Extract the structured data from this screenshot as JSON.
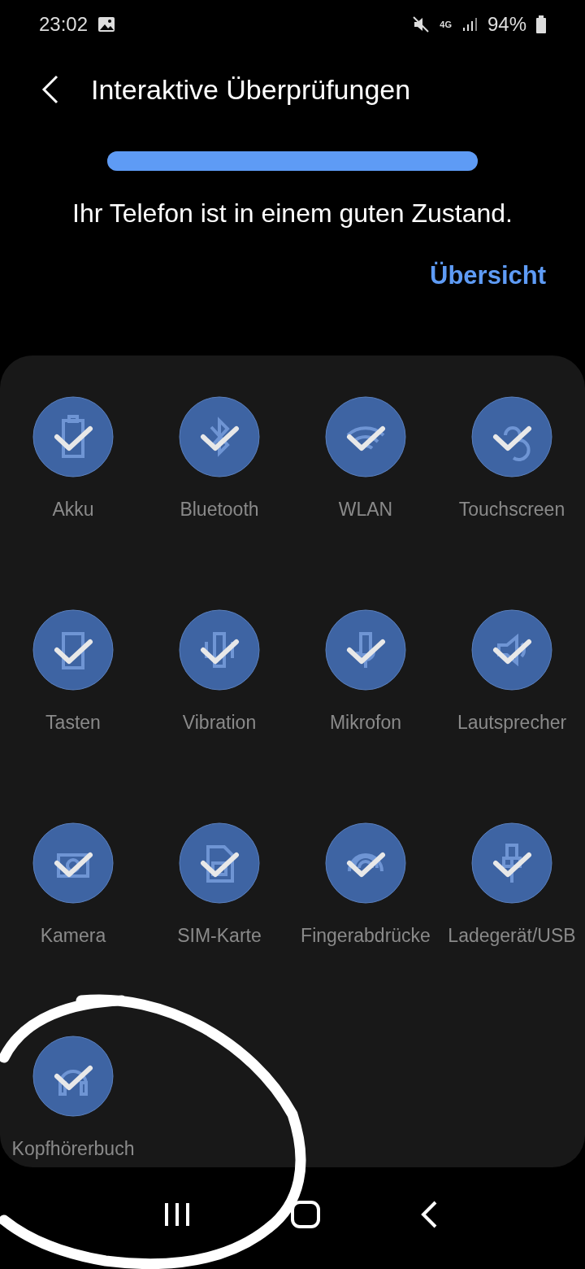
{
  "status_bar": {
    "time": "23:02",
    "network": "4G",
    "battery": "94%"
  },
  "header": {
    "title": "Interaktive Überprüfungen"
  },
  "progress": {
    "level": 1
  },
  "message": "Ihr Telefon ist in einem guten Zustand.",
  "overview_link": "Übersicht",
  "checks": [
    {
      "label": "Akku",
      "passed": true
    },
    {
      "label": "Bluetooth",
      "passed": true
    },
    {
      "label": "WLAN",
      "passed": true
    },
    {
      "label": "Touchscreen",
      "passed": true
    },
    {
      "label": "Tasten",
      "passed": true
    },
    {
      "label": "Vibration",
      "passed": true
    },
    {
      "label": "Mikrofon",
      "passed": true
    },
    {
      "label": "Lautsprecher",
      "passed": true
    },
    {
      "label": "Kamera",
      "passed": true
    },
    {
      "label": "SIM-Karte",
      "passed": true
    },
    {
      "label": "Fingerabdrücke",
      "passed": true
    },
    {
      "label": "Ladegerät/USB",
      "passed": true
    },
    {
      "label": "Kopfhörerbuch",
      "passed": true
    }
  ]
}
